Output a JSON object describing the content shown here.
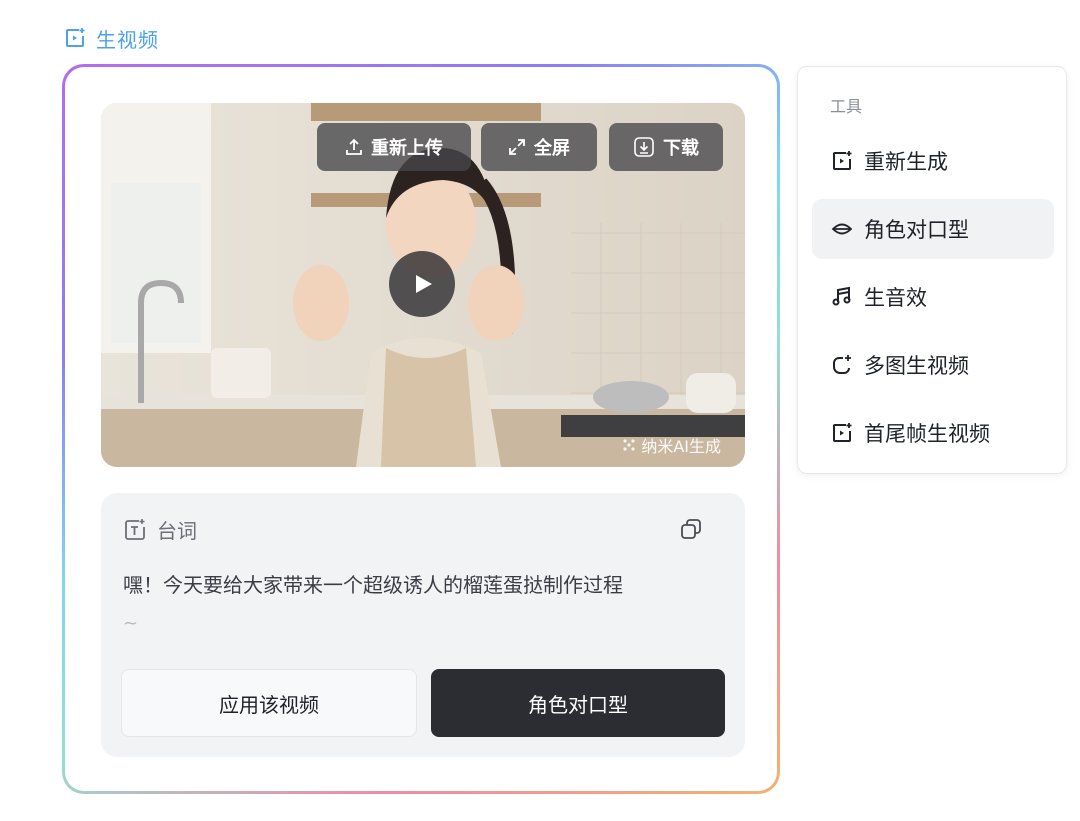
{
  "header": {
    "title": "生视频",
    "icon": "video-sparkle-icon",
    "color": "#4aa3e8"
  },
  "video": {
    "buttons": {
      "reupload": "重新上传",
      "fullscreen": "全屏",
      "download": "下载"
    },
    "watermark": "纳米AI生成"
  },
  "script": {
    "label": "台词",
    "text": "嘿！今天要给大家带来一个超级诱人的榴莲蛋挞制作过程",
    "continuation": "~"
  },
  "actions": {
    "apply": "应用该视频",
    "lip_sync": "角色对口型"
  },
  "tools": {
    "title": "工具",
    "items": [
      {
        "label": "重新生成",
        "icon": "video-sparkle-icon"
      },
      {
        "label": "角色对口型",
        "icon": "lips-icon",
        "active": true
      },
      {
        "label": "生音效",
        "icon": "music-note-icon"
      },
      {
        "label": "多图生视频",
        "icon": "multi-image-icon"
      },
      {
        "label": "首尾帧生视频",
        "icon": "frame-video-icon"
      }
    ]
  }
}
